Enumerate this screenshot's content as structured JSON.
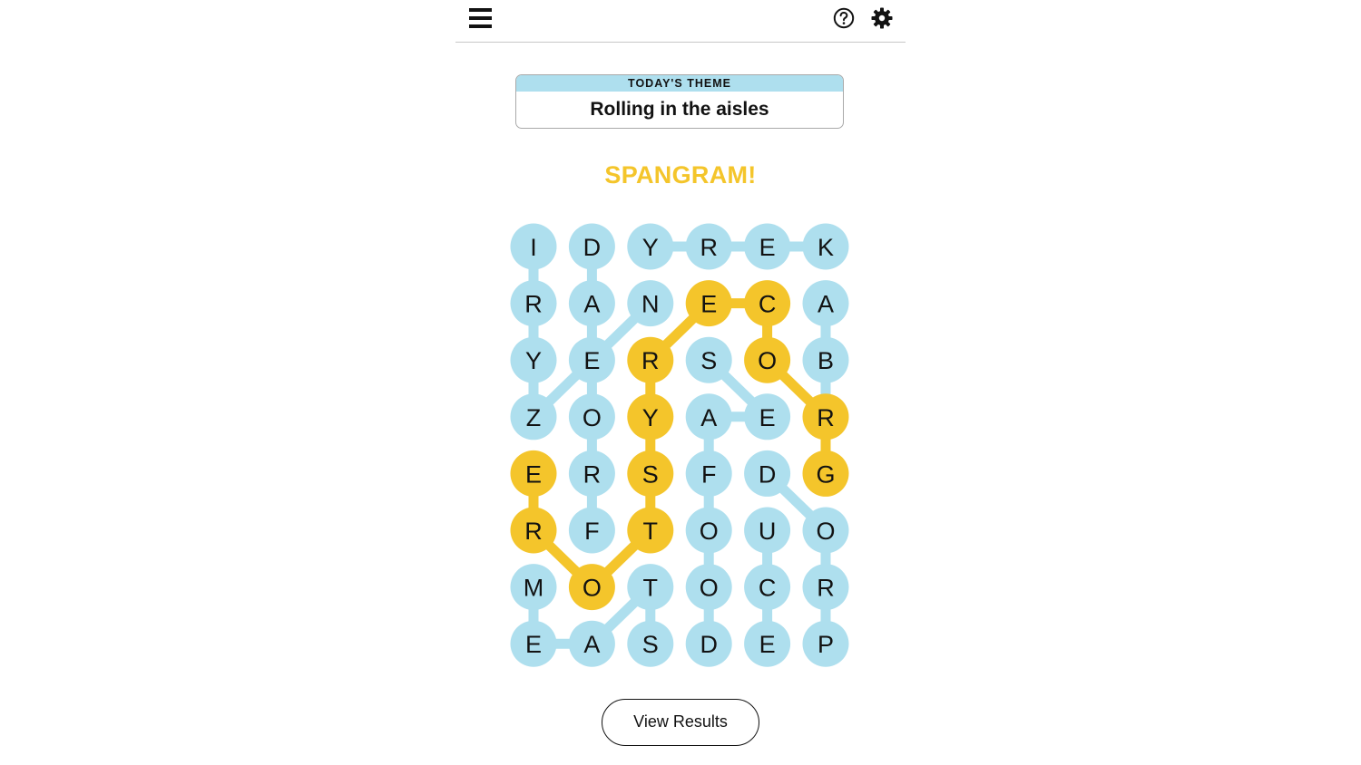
{
  "toolbar": {
    "menu_icon": "hamburger-menu-icon",
    "help_icon": "help-circle-icon",
    "settings_icon": "gear-icon"
  },
  "theme": {
    "header": "TODAY'S THEME",
    "title": "Rolling in the aisles"
  },
  "message": "SPANGRAM!",
  "colors": {
    "found_word": "#aedfee",
    "spangram": "#f4c52b",
    "text": "#121212"
  },
  "grid": {
    "rows": 8,
    "cols": 6,
    "letters": [
      [
        "I",
        "D",
        "Y",
        "R",
        "E",
        "K"
      ],
      [
        "R",
        "A",
        "N",
        "E",
        "C",
        "A"
      ],
      [
        "Y",
        "E",
        "R",
        "S",
        "O",
        "B"
      ],
      [
        "Z",
        "O",
        "Y",
        "A",
        "E",
        "R"
      ],
      [
        "E",
        "R",
        "S",
        "F",
        "D",
        "G"
      ],
      [
        "R",
        "F",
        "T",
        "O",
        "U",
        "O"
      ],
      [
        "M",
        "O",
        "T",
        "O",
        "C",
        "R"
      ],
      [
        "E",
        "A",
        "S",
        "D",
        "E",
        "P"
      ]
    ],
    "words": [
      {
        "type": "theme",
        "path": [
          [
            0,
            0
          ],
          [
            1,
            0
          ],
          [
            2,
            0
          ],
          [
            3,
            0
          ]
        ]
      },
      {
        "type": "theme",
        "path": [
          [
            0,
            1
          ],
          [
            1,
            1
          ],
          [
            2,
            1
          ],
          [
            3,
            1
          ],
          [
            4,
            1
          ],
          [
            5,
            1
          ]
        ]
      },
      {
        "type": "theme",
        "path": [
          [
            0,
            2
          ],
          [
            0,
            3
          ],
          [
            0,
            4
          ],
          [
            0,
            5
          ]
        ]
      },
      {
        "type": "theme",
        "path": [
          [
            1,
            5
          ],
          [
            2,
            5
          ],
          [
            3,
            5
          ]
        ]
      },
      {
        "type": "theme",
        "path": [
          [
            1,
            2
          ],
          [
            2,
            1
          ],
          [
            3,
            0
          ]
        ]
      },
      {
        "type": "theme",
        "path": [
          [
            2,
            3
          ],
          [
            3,
            4
          ],
          [
            3,
            3
          ],
          [
            4,
            3
          ],
          [
            5,
            3
          ],
          [
            6,
            3
          ],
          [
            7,
            3
          ]
        ]
      },
      {
        "type": "theme",
        "path": [
          [
            4,
            4
          ],
          [
            5,
            5
          ],
          [
            6,
            5
          ],
          [
            7,
            5
          ]
        ]
      },
      {
        "type": "theme",
        "path": [
          [
            5,
            4
          ],
          [
            6,
            4
          ],
          [
            7,
            4
          ]
        ]
      },
      {
        "type": "theme",
        "path": [
          [
            6,
            0
          ],
          [
            7,
            0
          ],
          [
            7,
            1
          ],
          [
            6,
            2
          ],
          [
            7,
            2
          ]
        ]
      },
      {
        "type": "spangram",
        "path": [
          [
            4,
            0
          ],
          [
            5,
            0
          ],
          [
            6,
            1
          ],
          [
            5,
            2
          ],
          [
            4,
            2
          ],
          [
            3,
            2
          ],
          [
            2,
            2
          ],
          [
            1,
            3
          ],
          [
            1,
            4
          ],
          [
            2,
            4
          ],
          [
            3,
            5
          ],
          [
            4,
            5
          ]
        ]
      }
    ]
  },
  "results_button": "View Results"
}
